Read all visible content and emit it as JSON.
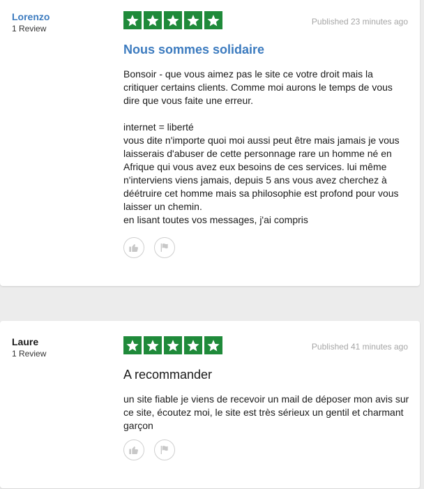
{
  "reviews": [
    {
      "reviewer_name": "Lorenzo",
      "review_count": "1 Review",
      "rating": 5,
      "published": "Published 23 minutes ago",
      "title": "Nous sommes solidaire",
      "paragraphs": [
        "Bonsoir - que vous aimez pas le site ce votre droit mais la critiquer certains clients. Comme moi aurons le temps de vous dire que vous faite une erreur.",
        "",
        "internet = liberté",
        "vous dite n'importe quoi moi aussi peut être mais jamais je vous laisserais d'abuser de cette personnage rare un homme né en Afrique qui vous avez eux besoins de ces services. lui même n'interviens viens jamais, depuis 5 ans vous avez cherchez à déétruire cet homme mais sa philosophie est profond pour vous laisser un chemin.",
        "en lisant toutes vos messages, j'ai compris"
      ]
    },
    {
      "reviewer_name": "Laure",
      "review_count": "1 Review",
      "rating": 5,
      "published": "Published 41 minutes ago",
      "title": "A recommander",
      "paragraphs": [
        "un site fiable je viens de recevoir un mail de déposer mon avis sur ce site, écoutez moi, le site est très sérieux un gentil et charmant garçon"
      ]
    }
  ],
  "icons": {
    "star": "star-icon",
    "like": "thumbs-up-icon",
    "flag": "flag-icon"
  },
  "colors": {
    "star_bg": "#1f8a3a",
    "link": "#3c7bbf",
    "muted": "#a6a6a6"
  }
}
